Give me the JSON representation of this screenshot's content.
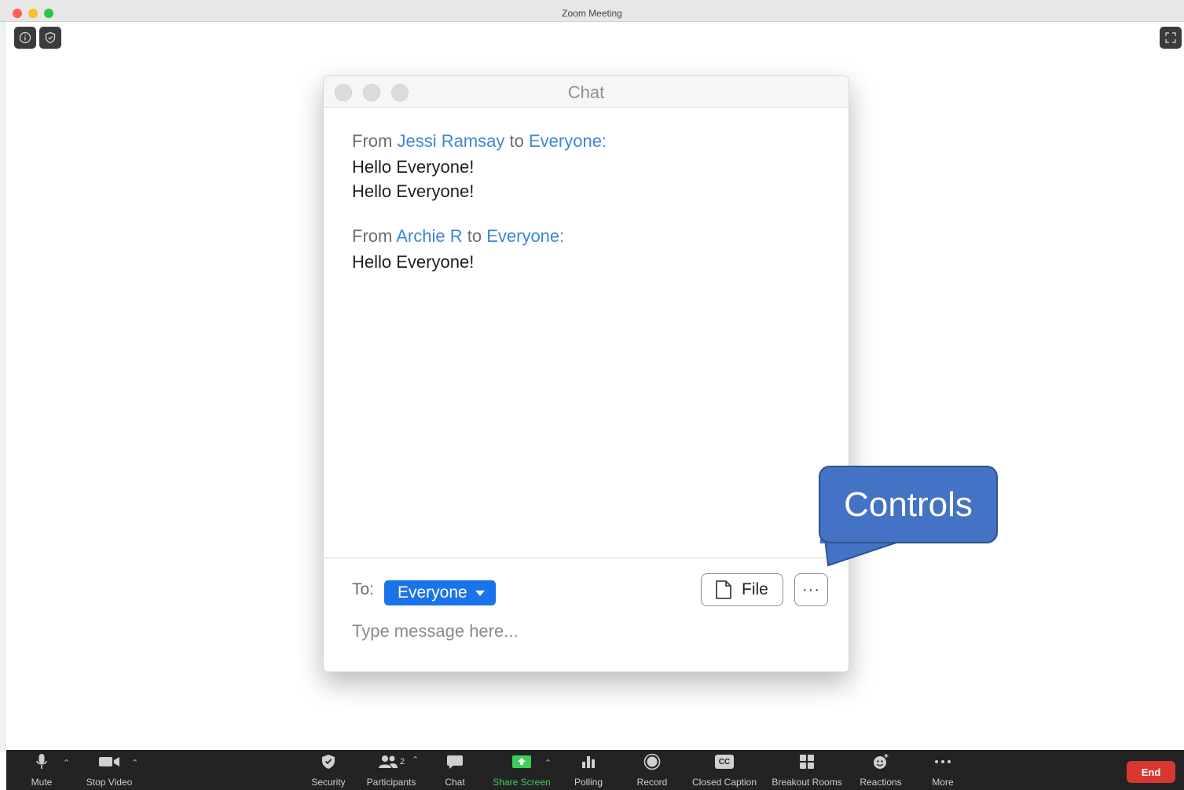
{
  "window": {
    "title": "Zoom Meeting"
  },
  "chat": {
    "title": "Chat",
    "messages": [
      {
        "from_prefix": "From",
        "sender": "Jessi Ramsay",
        "to_word": "to",
        "recipient": "Everyone",
        "colon": ":",
        "lines": [
          "Hello Everyone!",
          "Hello Everyone!"
        ]
      },
      {
        "from_prefix": "From",
        "sender": "Archie R",
        "to_word": "to",
        "recipient": "Everyone",
        "colon": ":",
        "lines": [
          "Hello Everyone!"
        ]
      }
    ],
    "to_label": "To:",
    "to_value": "Everyone",
    "file_label": "File",
    "more_label": "···",
    "input_placeholder": "Type message here..."
  },
  "callout": {
    "text": "Controls",
    "color": "#4472c4"
  },
  "toolbar": {
    "items": [
      {
        "label": "Mute",
        "icon": "microphone-icon"
      },
      {
        "label": "Stop Video",
        "icon": "video-camera-icon"
      },
      {
        "label": "Security",
        "icon": "shield-icon"
      },
      {
        "label": "Participants",
        "icon": "participants-icon",
        "count": "2"
      },
      {
        "label": "Chat",
        "icon": "chat-bubble-icon"
      },
      {
        "label": "Share Screen",
        "icon": "share-screen-icon",
        "color": "#3ecf5a"
      },
      {
        "label": "Polling",
        "icon": "bar-chart-icon"
      },
      {
        "label": "Record",
        "icon": "record-icon"
      },
      {
        "label": "Closed Caption",
        "icon": "cc-icon",
        "icon_text": "CC"
      },
      {
        "label": "Breakout Rooms",
        "icon": "breakout-rooms-icon"
      },
      {
        "label": "Reactions",
        "icon": "emoji-icon"
      },
      {
        "label": "More",
        "icon": "more-dots-icon"
      }
    ],
    "end_label": "End",
    "end_color": "#d9372f"
  }
}
